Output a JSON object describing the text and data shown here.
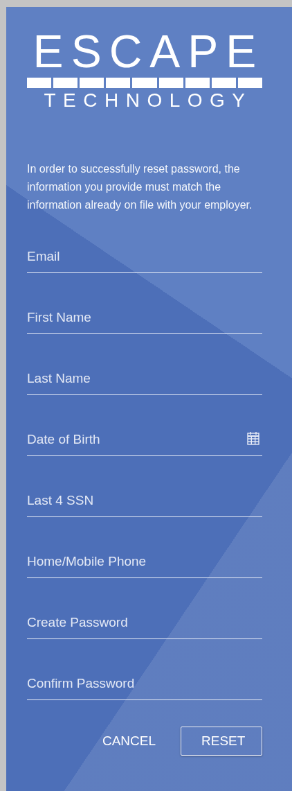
{
  "logo": {
    "word": "ESCAPE",
    "subtitle": "TECHNOLOGY"
  },
  "intro": "In order to successfully reset password, the information you provide must match the information already on file with your employer.",
  "fields": [
    {
      "kind": "text",
      "placeholder": "Email"
    },
    {
      "kind": "text",
      "placeholder": "First Name"
    },
    {
      "kind": "text",
      "placeholder": "Last Name"
    },
    {
      "kind": "date",
      "placeholder": "Date of Birth"
    },
    {
      "kind": "text",
      "placeholder": "Last 4 SSN"
    },
    {
      "kind": "text",
      "placeholder": "Home/Mobile Phone"
    },
    {
      "kind": "password",
      "placeholder": "Create Password"
    },
    {
      "kind": "password",
      "placeholder": "Confirm Password"
    }
  ],
  "buttons": [
    {
      "kind": "flat",
      "label": "CANCEL"
    },
    {
      "kind": "outlined",
      "label": "RESET"
    }
  ]
}
